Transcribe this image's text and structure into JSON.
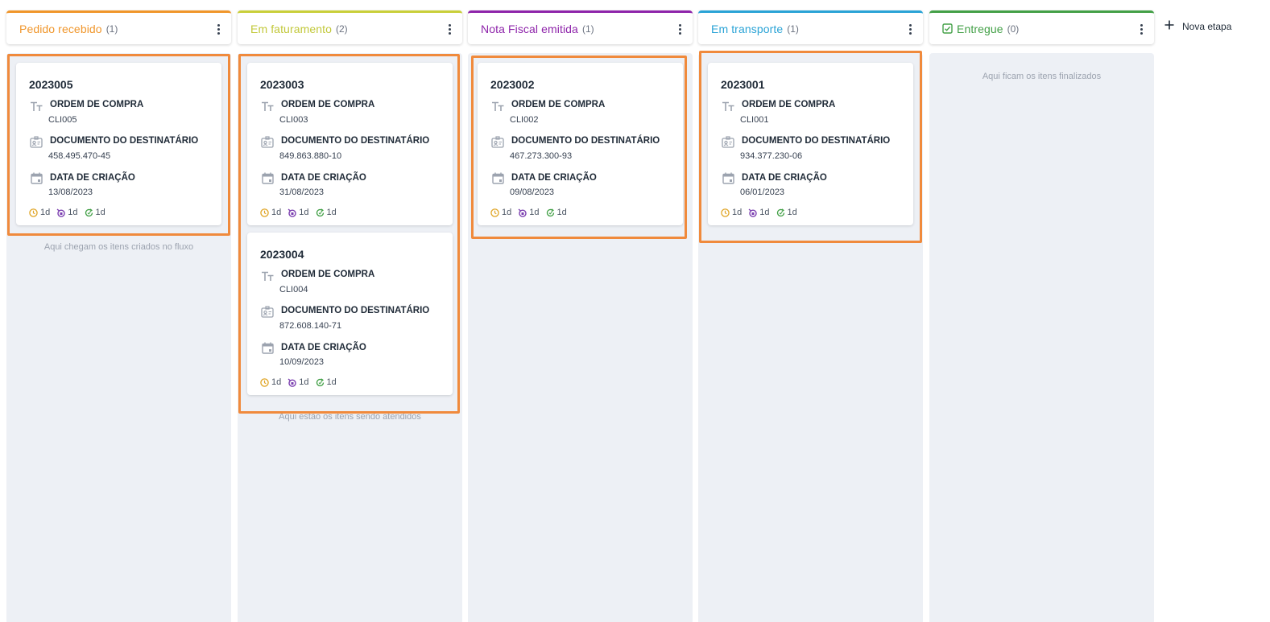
{
  "columns": [
    {
      "title": "Pedido recebido",
      "count": "(1)",
      "color": "#f0962b",
      "hint": "Aqui chegam os itens criados no fluxo"
    },
    {
      "title": "Em faturamento",
      "count": "(2)",
      "color": "#c9cf3a",
      "hint": "Aqui estão os itens sendo atendidos"
    },
    {
      "title": "Nota Fiscal emitida",
      "count": "(1)",
      "color": "#8e24aa",
      "hint": ""
    },
    {
      "title": "Em transporte",
      "count": "(1)",
      "color": "#2aa3d6",
      "hint": ""
    },
    {
      "title": "Entregue",
      "count": "(0)",
      "color": "#43a047",
      "hint": "Aqui ficam os itens finalizados"
    }
  ],
  "field_labels": {
    "order": "ORDEM DE COMPRA",
    "document": "DOCUMENTO DO DESTINATÁRIO",
    "created": "DATA DE CRIAÇÃO"
  },
  "cards": [
    {
      "id": "2023005",
      "order": "CLI005",
      "document": "458.495.470-45",
      "created": "13/08/2023",
      "t1": "1d",
      "t2": "1d",
      "t3": "1d"
    },
    {
      "id": "2023003",
      "order": "CLI003",
      "document": "849.863.880-10",
      "created": "31/08/2023",
      "t1": "1d",
      "t2": "1d",
      "t3": "1d"
    },
    {
      "id": "2023004",
      "order": "CLI004",
      "document": "872.608.140-71",
      "created": "10/09/2023",
      "t1": "1d",
      "t2": "1d",
      "t3": "1d"
    },
    {
      "id": "2023002",
      "order": "CLI002",
      "document": "467.273.300-93",
      "created": "09/08/2023",
      "t1": "1d",
      "t2": "1d",
      "t3": "1d"
    },
    {
      "id": "2023001",
      "order": "CLI001",
      "document": "934.377.230-06",
      "created": "06/01/2023",
      "t1": "1d",
      "t2": "1d",
      "t3": "1d"
    }
  ],
  "new_stage": {
    "label": "Nova etapa"
  },
  "icons": {
    "text": "text-format-icon",
    "id": "id-card-icon",
    "date": "calendar-icon",
    "timer1": "clock-icon",
    "timer2": "hourglass-icon",
    "timer3": "refresh-icon",
    "kebab": "more-vertical-icon",
    "done": "checkbox-icon",
    "add": "plus-icon"
  },
  "colors": {
    "highlight": "#f08a3c",
    "lane": "#edf0f5"
  }
}
